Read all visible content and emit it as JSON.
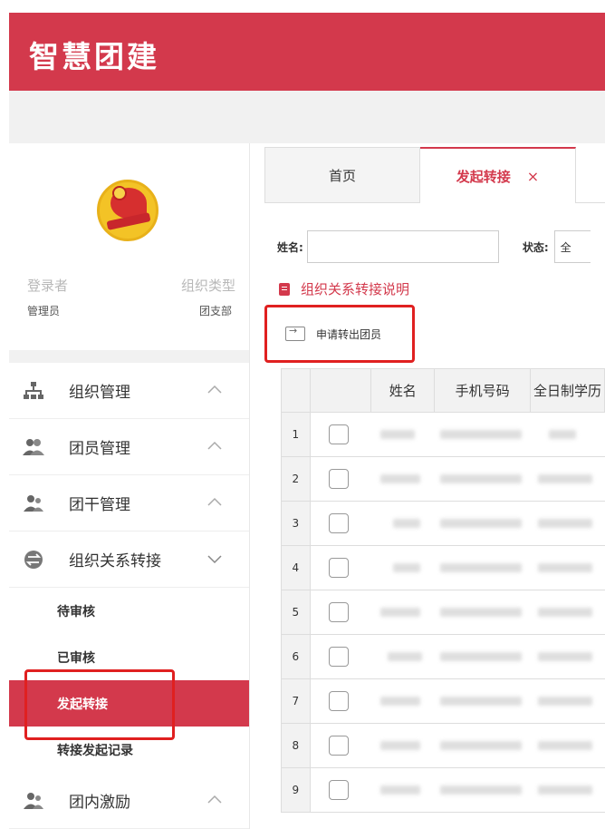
{
  "app": {
    "title": "智慧团建"
  },
  "user": {
    "login_label": "登录者",
    "org_type_label": "组织类型",
    "login_value": "管理员",
    "org_type_value": "团支部"
  },
  "sidebar": {
    "menu": [
      {
        "label": "组织管理",
        "icon": "org-chart-icon",
        "expanded": false
      },
      {
        "label": "团员管理",
        "icon": "members-icon",
        "expanded": false
      },
      {
        "label": "团干管理",
        "icon": "cadres-icon",
        "expanded": false
      },
      {
        "label": "组织关系转接",
        "icon": "transfer-icon",
        "expanded": true
      },
      {
        "label": "团内激励",
        "icon": "incentive-icon",
        "expanded": false
      }
    ],
    "submenu": [
      {
        "label": "待审核",
        "active": false
      },
      {
        "label": "已审核",
        "active": false
      },
      {
        "label": "发起转接",
        "active": true
      },
      {
        "label": "转接发起记录",
        "active": false
      }
    ]
  },
  "tabs": {
    "home": "首页",
    "active": "发起转接",
    "close": "×"
  },
  "filter": {
    "name_label": "姓名:",
    "name_value": "",
    "status_label": "状态:",
    "status_value": "全"
  },
  "notice": {
    "text": "组织关系转接说明"
  },
  "actions": {
    "apply_transfer_out": "申请转出团员"
  },
  "table": {
    "columns": [
      "姓名",
      "手机号码",
      "全日制学历"
    ],
    "rows": [
      "1",
      "2",
      "3",
      "4",
      "5",
      "6",
      "7",
      "8",
      "9"
    ]
  },
  "colors": {
    "brand_red": "#d3394c",
    "highlight_red": "#e02020"
  }
}
